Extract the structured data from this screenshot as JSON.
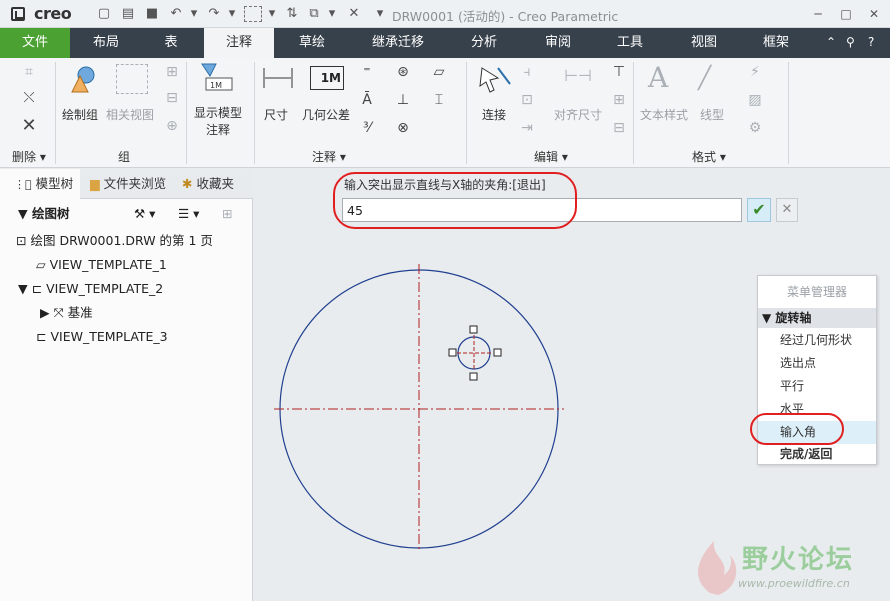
{
  "app": {
    "brand": "creo",
    "window_title": "DRW0001 (活动的) - Creo Parametric"
  },
  "tabs": [
    {
      "label": "文件"
    },
    {
      "label": "布局"
    },
    {
      "label": "表"
    },
    {
      "label": "注释"
    },
    {
      "label": "草绘"
    },
    {
      "label": "继承迁移"
    },
    {
      "label": "分析"
    },
    {
      "label": "审阅"
    },
    {
      "label": "工具"
    },
    {
      "label": "视图"
    },
    {
      "label": "框架"
    }
  ],
  "ribbon": {
    "delete_group": "删除",
    "group_group": "组",
    "draw_group_btn": "绘制组",
    "related_view_btn": "相关视图",
    "show_model_annot_1": "显示模型",
    "show_model_annot_2": "注释",
    "dimension_btn": "尺寸",
    "geo_tol_btn": "几何公差",
    "annotation_group": "注释",
    "connect_btn": "连接",
    "align_dim_btn": "对齐尺寸",
    "edit_group": "编辑",
    "text_style_btn": "文本样式",
    "line_type_btn": "线型",
    "format_group": "格式",
    "geo_tol_icon_text": "1M"
  },
  "left_panel": {
    "tabs": [
      {
        "label": "模型树"
      },
      {
        "label": "文件夹浏览"
      },
      {
        "label": "收藏夹"
      }
    ],
    "tree_header": "绘图树",
    "rows": [
      {
        "label": "绘图 DRW0001.DRW 的第 1 页"
      },
      {
        "label": "VIEW_TEMPLATE_1"
      },
      {
        "label": "VIEW_TEMPLATE_2"
      },
      {
        "label": "基准"
      },
      {
        "label": "VIEW_TEMPLATE_3"
      }
    ]
  },
  "prompt": {
    "label": "输入突出显示直线与X轴的夹角:[退出]",
    "value": "45"
  },
  "menu_manager": {
    "title": "菜单管理器",
    "header": "旋转轴",
    "items": [
      {
        "label": "经过几何形状"
      },
      {
        "label": "选出点"
      },
      {
        "label": "平行"
      },
      {
        "label": "水平"
      },
      {
        "label": "输入角"
      },
      {
        "label": "完成/返回"
      }
    ]
  },
  "watermark": {
    "name": "野火论坛",
    "url": "www.proewildfire.cn"
  },
  "colors": {
    "file_tab": "#4ca133",
    "tab_bar": "#37414b",
    "circle": "#1f3f8f",
    "axis_line": "#b02020",
    "annotation": "#e02020"
  }
}
